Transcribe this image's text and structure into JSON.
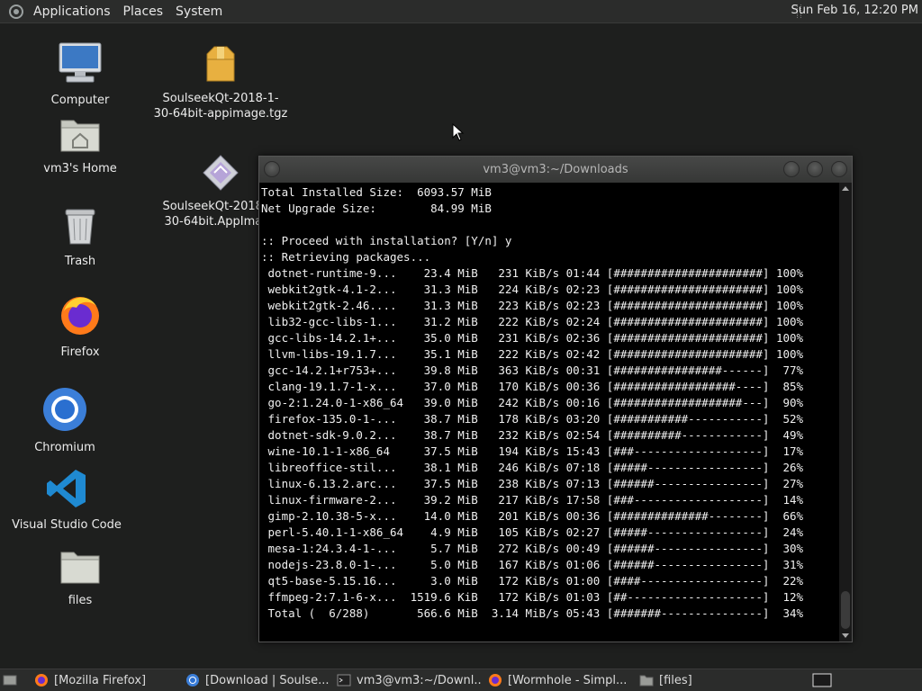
{
  "top_panel": {
    "menus": [
      "Applications",
      "Places",
      "System"
    ],
    "clock": "Sun Feb 16, 12:20 PM"
  },
  "desktop_icons": [
    {
      "label": "Computer",
      "icon": "computer-icon"
    },
    {
      "label": "vm3's Home",
      "icon": "home-folder-icon"
    },
    {
      "label": "Trash",
      "icon": "trash-icon"
    },
    {
      "label": "Firefox",
      "icon": "firefox-icon"
    },
    {
      "label": "Chromium",
      "icon": "chromium-icon"
    },
    {
      "label": "Visual Studio Code",
      "icon": "vscode-icon"
    },
    {
      "label": "files",
      "icon": "folder-icon"
    },
    {
      "label": "SoulseekQt-2018-1-30-64bit-appimage.tgz",
      "icon": "archive-icon"
    },
    {
      "label": "SoulseekQt-2018-1-30-64bit.AppImage",
      "icon": "appimage-icon"
    }
  ],
  "terminal": {
    "title": "vm3@vm3:~/Downloads",
    "lines": [
      "Total Installed Size:  6093.57 MiB",
      "Net Upgrade Size:        84.99 MiB",
      "",
      ":: Proceed with installation? [Y/n] y",
      ":: Retrieving packages...",
      " dotnet-runtime-9...    23.4 MiB   231 KiB/s 01:44 [######################] 100%",
      " webkit2gtk-4.1-2...    31.3 MiB   224 KiB/s 02:23 [######################] 100%",
      " webkit2gtk-2.46....    31.3 MiB   223 KiB/s 02:23 [######################] 100%",
      " lib32-gcc-libs-1...    31.2 MiB   222 KiB/s 02:24 [######################] 100%",
      " gcc-libs-14.2.1+...    35.0 MiB   231 KiB/s 02:36 [######################] 100%",
      " llvm-libs-19.1.7...    35.1 MiB   222 KiB/s 02:42 [######################] 100%",
      " gcc-14.2.1+r753+...    39.8 MiB   363 KiB/s 00:31 [################------]  77%",
      " clang-19.1.7-1-x...    37.0 MiB   170 KiB/s 00:36 [##################----]  85%",
      " go-2:1.24.0-1-x86_64   39.0 MiB   242 KiB/s 00:16 [###################---]  90%",
      " firefox-135.0-1-...    38.7 MiB   178 KiB/s 03:20 [###########-----------]  52%",
      " dotnet-sdk-9.0.2...    38.7 MiB   232 KiB/s 02:54 [##########------------]  49%",
      " wine-10.1-1-x86_64     37.5 MiB   194 KiB/s 15:43 [###-------------------]  17%",
      " libreoffice-stil...    38.1 MiB   246 KiB/s 07:18 [#####-----------------]  26%",
      " linux-6.13.2.arc...    37.5 MiB   238 KiB/s 07:13 [######----------------]  27%",
      " linux-firmware-2...    39.2 MiB   217 KiB/s 17:58 [###-------------------]  14%",
      " gimp-2.10.38-5-x...    14.0 MiB   201 KiB/s 00:36 [##############--------]  66%",
      " perl-5.40.1-1-x86_64    4.9 MiB   105 KiB/s 02:27 [#####-----------------]  24%",
      " mesa-1:24.3.4-1-...     5.7 MiB   272 KiB/s 00:49 [######----------------]  30%",
      " nodejs-23.8.0-1-...     5.0 MiB   167 KiB/s 01:06 [######----------------]  31%",
      " qt5-base-5.15.16...     3.0 MiB   172 KiB/s 01:00 [####------------------]  22%",
      " ffmpeg-2:7.1-6-x...  1519.6 KiB   172 KiB/s 01:03 [##--------------------]  12%",
      " Total (  6/288)       566.6 MiB  3.14 MiB/s 05:43 [#######---------------]  34%"
    ]
  },
  "taskbar": {
    "tasks": [
      {
        "label": "[Mozilla Firefox]",
        "icon": "firefox-icon"
      },
      {
        "label": "[Download | Soulse...",
        "icon": "chromium-icon"
      },
      {
        "label": "vm3@vm3:~/Downl...",
        "icon": "terminal-icon"
      },
      {
        "label": "[Wormhole - Simpl...",
        "icon": "firefox-icon"
      },
      {
        "label": "[files]",
        "icon": "folder-icon"
      }
    ]
  },
  "colors": {
    "desktop_bg": "#1e1f1e",
    "panel_bg": "#2b2c2b",
    "terminal_bg": "#000000",
    "terminal_fg": "#f0f0f0",
    "vscode_blue": "#1f8ad2",
    "firefox_orange": "#ff7a1a",
    "chromium_blue": "#3b7ed8"
  }
}
